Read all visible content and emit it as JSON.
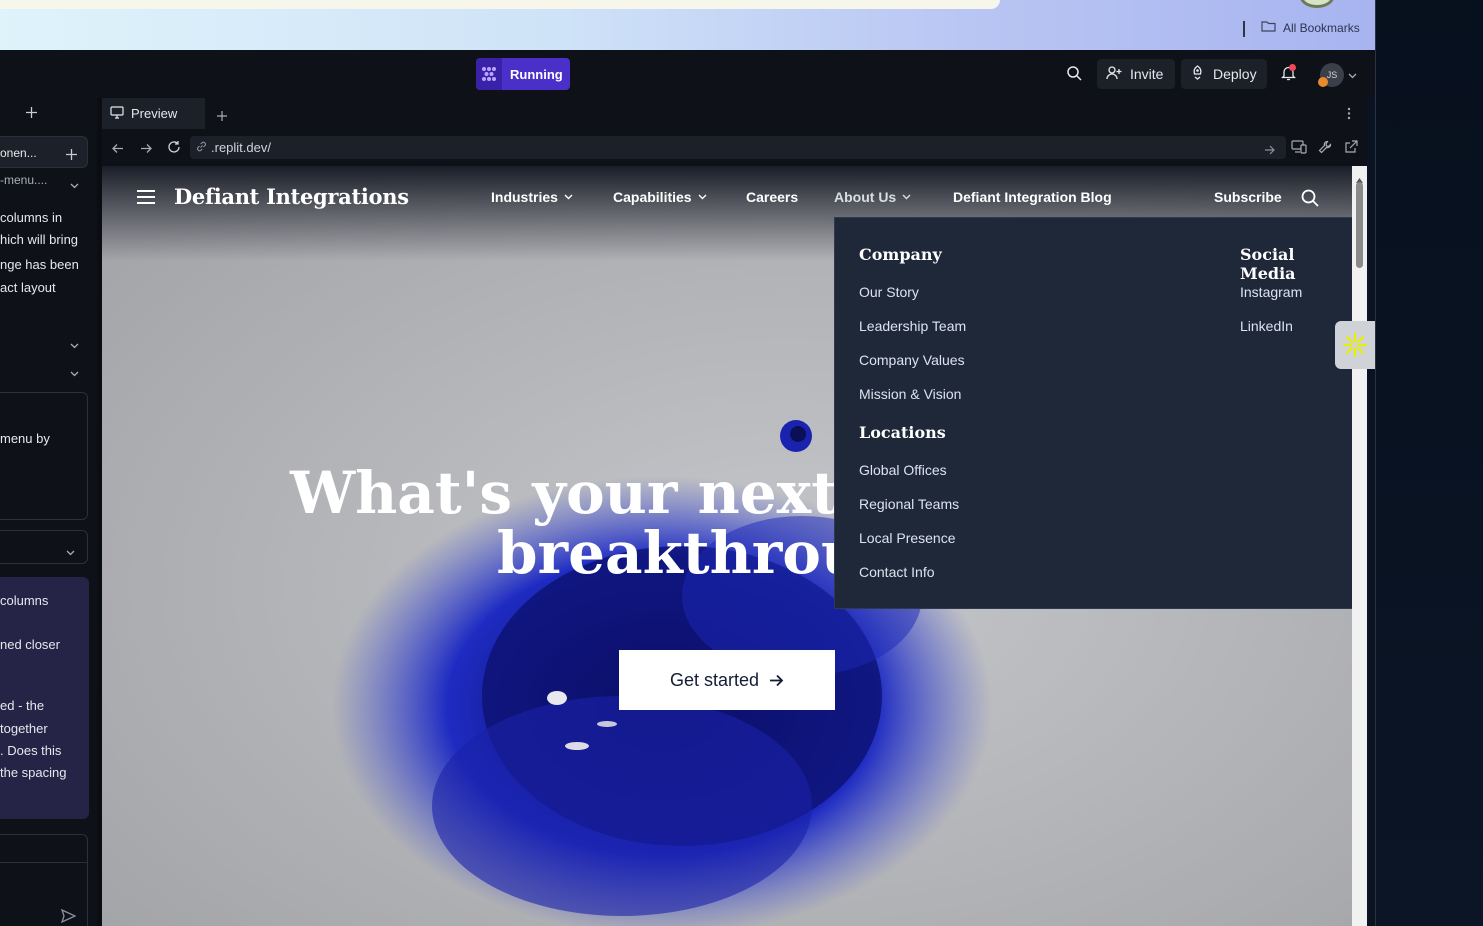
{
  "browser": {
    "bookmarks_label": "All Bookmarks"
  },
  "replit_header": {
    "run_label": "Running",
    "invite_label": "Invite",
    "deploy_label": "Deploy",
    "avatar_initials": "JS"
  },
  "left_panel": {
    "lines": [
      "onen...",
      "-menu....",
      "columns in",
      "hich will bring",
      "nge has been",
      "act layout",
      "menu by",
      "columns",
      "ned closer",
      "ed - the",
      "together",
      ". Does this",
      "the spacing"
    ]
  },
  "preview": {
    "tab_label": "Preview",
    "url": ".replit.dev/"
  },
  "site": {
    "brand": "Defiant Integrations",
    "nav": {
      "industries": "Industries",
      "capabilities": "Capabilities",
      "careers": "Careers",
      "about": "About Us",
      "blog": "Defiant Integration Blog",
      "subscribe": "Subscribe"
    },
    "hero": {
      "line1": "What's your next",
      "line2": "breakthrou",
      "cta": "Get started"
    },
    "dropdown": {
      "company_heading": "Company",
      "company_links": [
        "Our Story",
        "Leadership Team",
        "Company Values",
        "Mission & Vision"
      ],
      "locations_heading": "Locations",
      "locations_links": [
        "Global Offices",
        "Regional Teams",
        "Local Presence",
        "Contact Info"
      ],
      "social_heading": "Social Media",
      "social_links": [
        "Instagram",
        "LinkedIn"
      ]
    }
  },
  "colors": {
    "run_button": "#4b2fc9",
    "dropdown_bg": "#1e2839",
    "ink_blue": "#1a23b8"
  }
}
